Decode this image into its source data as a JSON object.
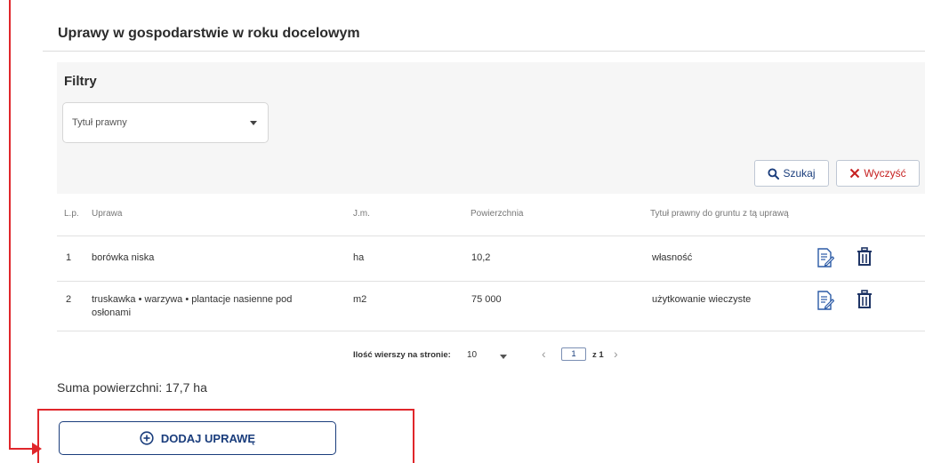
{
  "section": {
    "title": "Uprawy w gospodarstwie w roku docelowym"
  },
  "filters": {
    "title": "Filtry",
    "legal_title_select": {
      "placeholder": "Tytuł prawny",
      "icon": "chevron-down-icon"
    },
    "search_button": {
      "label": "Szukaj",
      "icon": "search-icon",
      "color": "#1a3d7c"
    },
    "clear_button": {
      "label": "Wyczyść",
      "icon": "close-icon",
      "color": "#c62020"
    }
  },
  "table": {
    "columns": [
      "L.p.",
      "Uprawa",
      "J.m.",
      "Powierzchnia",
      "Tytuł prawny do gruntu z tą uprawą"
    ],
    "rows": [
      {
        "lp": "1",
        "crop": "borówka niska",
        "crop_line2": "",
        "unit": "ha",
        "area": "10,2",
        "legal_title": "własność"
      },
      {
        "lp": "2",
        "crop": "truskawka • warzywa • plantacje nasienne pod",
        "crop_line2": "osłonami",
        "unit": "m2",
        "area": "75 000",
        "legal_title": "użytkowanie wieczyste"
      }
    ],
    "row_actions": [
      "edit-icon",
      "trash-icon"
    ]
  },
  "pagination": {
    "rows_per_page_label": "Ilość wierszy na stronie:",
    "rows_per_page": "10",
    "prev": "‹",
    "current_page": "1",
    "of_text": "z 1",
    "next": "›"
  },
  "summary": {
    "text": "Suma powierzchni: 17,7 ha"
  },
  "add_button": {
    "label": "DODAJ UPRAWĘ",
    "icon": "plus-circle-icon"
  },
  "colors": {
    "accent": "#1a3d7c",
    "highlight": "#e0262b",
    "danger": "#c62020",
    "filter_bg": "#f6f6f6"
  }
}
